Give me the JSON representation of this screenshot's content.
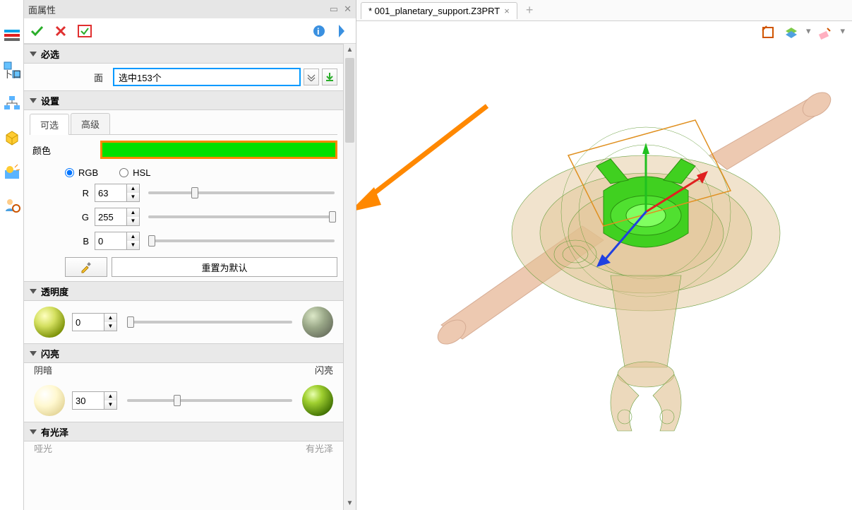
{
  "panel": {
    "title": "面属性",
    "sections": {
      "required": "必选",
      "settings": "设置",
      "transparency": "透明度",
      "shiny": "闪亮",
      "glossy": "有光泽"
    },
    "face_label": "面",
    "face_selection": "选中153个",
    "tabs": {
      "optional": "可选",
      "advanced": "高级"
    },
    "color_label": "颜色",
    "rgb_label": "RGB",
    "hsl_label": "HSL",
    "r_label": "R",
    "g_label": "G",
    "b_label": "B",
    "r_value": "63",
    "g_value": "255",
    "b_value": "0",
    "reset_default": "重置为默认",
    "transparency_value": "0",
    "shiny_dark": "阴暗",
    "shiny_bright": "闪亮",
    "shiny_value": "30",
    "gloss_dull": "哑光",
    "gloss_glossy": "有光泽",
    "color_swatch": "#00e000"
  },
  "tabs": {
    "document": "* 001_planetary_support.Z3PRT"
  }
}
